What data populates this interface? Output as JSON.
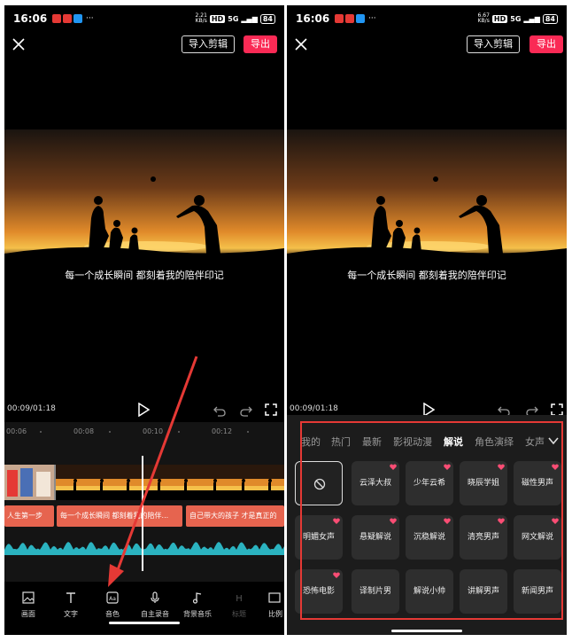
{
  "status": {
    "time": "16:06",
    "net_speed_left": "2.21",
    "net_speed_right": "6.67",
    "net_unit": "KB/s",
    "hd": "HD",
    "signal": "5G",
    "battery": "84",
    "dots": "···"
  },
  "header": {
    "import_label": "导入剪辑",
    "export_label": "导出",
    "close_icon": "close-icon"
  },
  "video": {
    "subtitle": "每一个成长瞬间 都刻着我的陪伴印记"
  },
  "controls": {
    "time": "00:09/01:18",
    "play_icon": "play-icon",
    "undo_icon": "undo-icon",
    "redo_icon": "redo-icon",
    "fullscreen_icon": "fullscreen-icon"
  },
  "timeline": {
    "ruler": [
      "00:06",
      "00:08",
      "00:10",
      "00:12"
    ],
    "captions": [
      "人生第一步",
      "每一个成长瞬间 都刻着我的陪伴...",
      "自己带大的孩子 才是真正的"
    ]
  },
  "toolbar": [
    {
      "label": "画面",
      "icon": "image-icon"
    },
    {
      "label": "文字",
      "icon": "text-icon"
    },
    {
      "label": "音色",
      "icon": "voice-tone-icon"
    },
    {
      "label": "自主录音",
      "icon": "microphone-icon"
    },
    {
      "label": "背景音乐",
      "icon": "music-icon"
    },
    {
      "label": "标题",
      "icon": "heading-icon"
    },
    {
      "label": "比例",
      "icon": "ratio-icon"
    }
  ],
  "voice_panel": {
    "categories": [
      "我的",
      "热门",
      "最新",
      "影视动漫",
      "解说",
      "角色演绎",
      "女声"
    ],
    "active_category": "解说",
    "voices": [
      {
        "label": "",
        "icon": "none-icon",
        "heart": false
      },
      {
        "label": "云泽大叔",
        "heart": true
      },
      {
        "label": "少年云希",
        "heart": true
      },
      {
        "label": "晓辰学姐",
        "heart": true
      },
      {
        "label": "磁性男声",
        "heart": true
      },
      {
        "label": "明媚女声",
        "heart": true
      },
      {
        "label": "悬疑解说",
        "heart": true
      },
      {
        "label": "沉稳解说",
        "heart": true
      },
      {
        "label": "清亮男声",
        "heart": true
      },
      {
        "label": "网文解说",
        "heart": true
      },
      {
        "label": "恐怖电影",
        "heart": true
      },
      {
        "label": "译制片男",
        "heart": false
      },
      {
        "label": "解说小帅",
        "heart": false
      },
      {
        "label": "讲解男声",
        "heart": false
      },
      {
        "label": "新闻男声",
        "heart": false
      }
    ]
  },
  "colors": {
    "accent": "#fa2a55",
    "highlight": "#e53935",
    "caption": "#e6644f",
    "wave": "#2bb3c0"
  }
}
